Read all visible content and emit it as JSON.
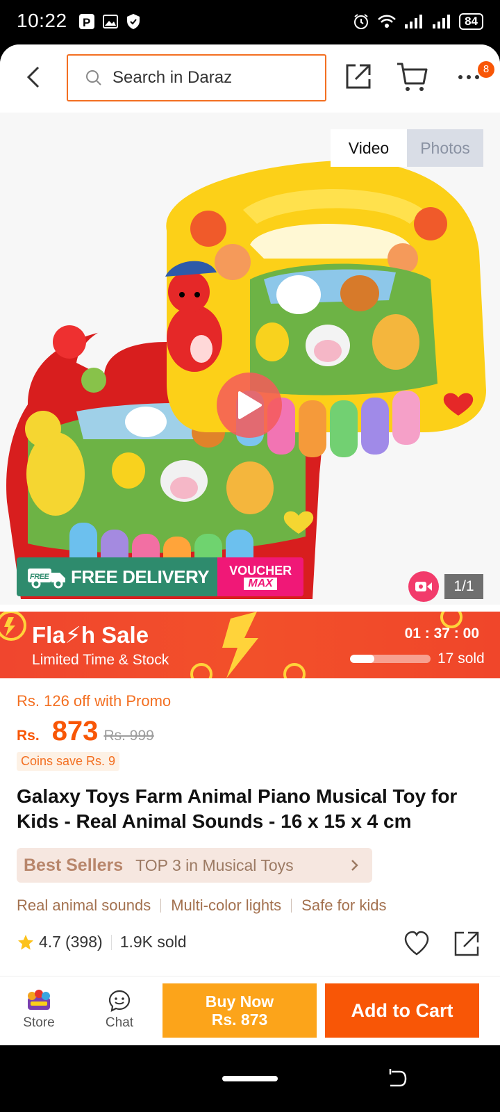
{
  "status_bar": {
    "time": "10:22",
    "battery": "84"
  },
  "header": {
    "search_placeholder": "Search in Daraz",
    "cart_badge": "8"
  },
  "gallery": {
    "tabs": [
      {
        "label": "Video",
        "active": true
      },
      {
        "label": "Photos",
        "active": false
      }
    ],
    "free_delivery_label": "FREE DELIVERY",
    "free_tag": "FREE",
    "voucher_top": "VOUCHER",
    "voucher_bottom": "MAX",
    "page_indicator": "1/1"
  },
  "flash_sale": {
    "title": "Fla⚡h Sale",
    "subtitle": "Limited Time & Stock",
    "timer": "01 : 37 : 00",
    "sold_text": "17 sold",
    "progress": 0.3
  },
  "product": {
    "promo_text": "Rs. 126 off with Promo",
    "currency": "Rs.",
    "price": "873",
    "original_price": "Rs. 999",
    "coins_text": "Coins save Rs. 9",
    "title": "Galaxy Toys Farm Animal Piano Musical Toy for Kids - Real Animal Sounds - 16 x 15 x 4 cm",
    "bestseller_label": "Best Sellers",
    "bestseller_text": "TOP 3 in Musical Toys",
    "features": [
      "Real animal sounds",
      "Multi-color lights",
      "Safe for kids"
    ],
    "rating": "4.7",
    "reviews": "(398)",
    "sold": "1.9K sold"
  },
  "bottom_bar": {
    "store_label": "Store",
    "chat_label": "Chat",
    "buy_now_label": "Buy Now",
    "buy_now_price": "Rs. 873",
    "add_to_cart_label": "Add to Cart"
  },
  "colors": {
    "accent": "#f85606",
    "buy_now": "#fca41a",
    "flash_bg": "#f0462e",
    "delivery_green": "#2e8b6d",
    "voucher_pink": "#f01877"
  }
}
